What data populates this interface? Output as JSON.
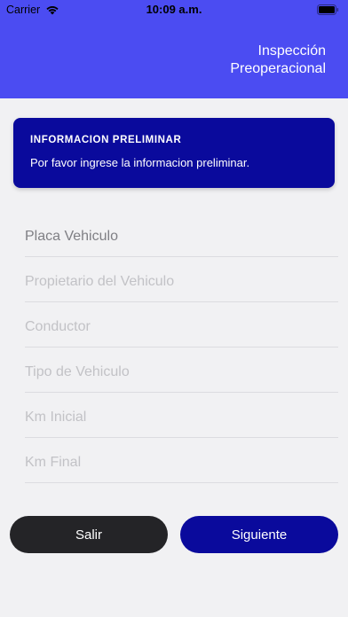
{
  "status_bar": {
    "carrier": "Carrier",
    "time": "10:09 a.m.",
    "wifi_icon": "wifi-icon",
    "battery_icon": "battery-icon"
  },
  "header": {
    "title_line1": "Inspección",
    "title_line2": "Preoperacional",
    "background_color": "#4b4cf2"
  },
  "info_card": {
    "title": "INFORMACION PRELIMINAR",
    "message": "Por favor ingrese la informacion preliminar.",
    "background_color": "#0a0a9c"
  },
  "form": {
    "fields": [
      {
        "placeholder": "Placa Vehiculo",
        "value": ""
      },
      {
        "placeholder": "Propietario del Vehiculo",
        "value": ""
      },
      {
        "placeholder": "Conductor",
        "value": ""
      },
      {
        "placeholder": "Tipo de Vehiculo",
        "value": ""
      },
      {
        "placeholder": "Km Inicial",
        "value": ""
      },
      {
        "placeholder": "Km Final",
        "value": ""
      }
    ]
  },
  "buttons": {
    "exit_label": "Salir",
    "next_label": "Siguiente"
  }
}
